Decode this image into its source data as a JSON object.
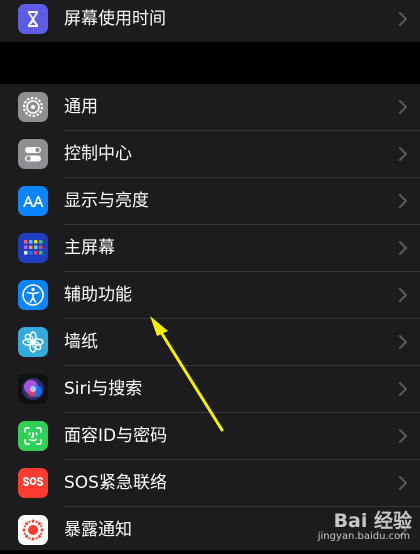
{
  "screen_time": {
    "label": "屏幕使用时间",
    "icon": "hourglass-icon"
  },
  "settings": [
    {
      "label": "通用",
      "icon": "gear-icon"
    },
    {
      "label": "控制中心",
      "icon": "toggles-icon"
    },
    {
      "label": "显示与亮度",
      "icon": "aa-text-icon"
    },
    {
      "label": "主屏幕",
      "icon": "app-grid-icon"
    },
    {
      "label": "辅助功能",
      "icon": "accessibility-icon"
    },
    {
      "label": "墙纸",
      "icon": "flower-icon"
    },
    {
      "label": "Siri与搜索",
      "icon": "siri-icon"
    },
    {
      "label": "面容ID与密码",
      "icon": "face-id-icon"
    },
    {
      "label": "SOS紧急联络",
      "icon": "sos-icon"
    },
    {
      "label": "暴露通知",
      "icon": "exposure-icon"
    }
  ],
  "watermark": {
    "brand": "Bai 经验",
    "url": "jingyan.baidu.com"
  },
  "colors": {
    "background": "#000000",
    "cell": "#1c1c1e",
    "separator": "#38383a",
    "annotation_arrow": "#f5f000"
  }
}
